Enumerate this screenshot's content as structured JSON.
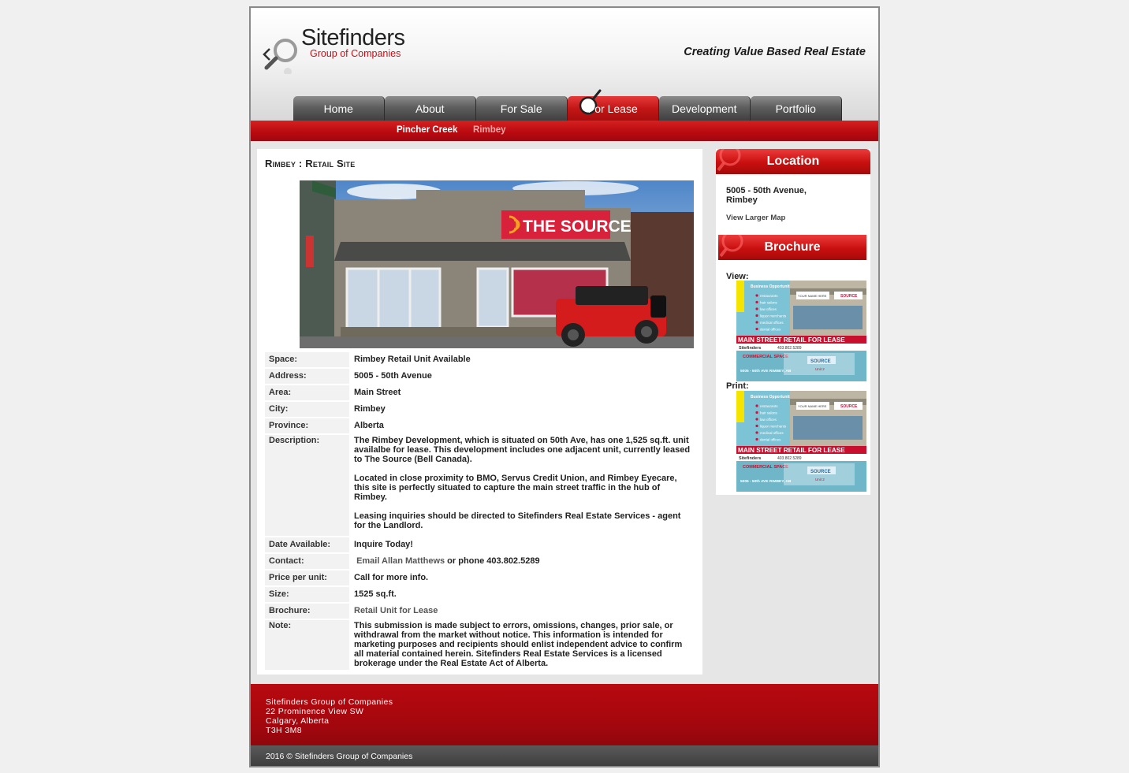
{
  "header": {
    "logo_name": "Sitefinders",
    "logo_sub": "Group of Companies",
    "tagline": "Creating Value Based Real Estate"
  },
  "nav": {
    "tabs": [
      {
        "label": "Home"
      },
      {
        "label": "About"
      },
      {
        "label": "For Sale"
      },
      {
        "label": "For Lease",
        "active": true
      },
      {
        "label": "Development"
      },
      {
        "label": "Portfolio"
      }
    ]
  },
  "subnav": {
    "items": [
      {
        "label": "Pincher Creek"
      },
      {
        "label": "Rimbey"
      }
    ]
  },
  "main": {
    "title": "Rimbey : Retail Site",
    "photo_sign": "THE SOURCE",
    "details": {
      "space_label": "Space:",
      "space": "Rimbey Retail Unit Available",
      "address_label": "Address:",
      "address": "5005 - 50th Avenue",
      "area_label": "Area:",
      "area": "Main Street",
      "city_label": "City:",
      "city": "Rimbey",
      "province_label": "Province:",
      "province": "Alberta",
      "description_label": "Description:",
      "description_p1": "The Rimbey Development, which is situated on 50th Ave, has one 1,525 sq.ft. unit availalbe for lease. This development includes one adjacent unit, currently leased to The Source (Bell Canada).",
      "description_p2": "Located in close proximity to BMO, Servus Credit Union, and Rimbey Eyecare, this site is perfectly situated to capture the main street traffic in the hub of Rimbey.",
      "description_p3": "Leasing inquiries should be directed to Sitefinders Real Estate Services - agent for the Landlord.",
      "date_label": "Date Available:",
      "date": "Inquire Today!",
      "contact_label": "Contact:",
      "contact_link": "Email Allan Matthews",
      "contact_rest": " or phone 403.802.5289",
      "price_label": "Price per unit:",
      "price": "Call for more info.",
      "size_label": "Size:",
      "size": "1525 sq.ft.",
      "brochure_label": "Brochure:",
      "brochure_link": "Retail Unit for Lease",
      "note_label": "Note:",
      "note": "This submission is made subject to errors, omissions, changes, prior sale, or withdrawal from the market without notice. This information is intended for marketing purposes and recipients should enlist independent advice to confirm all material contained herein. Sitefinders Real Estate Services is a licensed brokerage under the Real Estate Act of Alberta."
    }
  },
  "sidebar": {
    "location_title": "Location",
    "location_line1": "5005 - 50th Avenue,",
    "location_line2": "Rimbey",
    "view_map": "View Larger Map",
    "brochure_title": "Brochure",
    "view_label": "View:",
    "print_label": "Print:",
    "brochure_thumb": {
      "box_title": "Business Opportunities",
      "list": [
        "restaurants",
        "hair salons",
        "law offices",
        "liquor merchants",
        "medical offices",
        "dental offices"
      ],
      "banner": "MAIN STREET RETAIL FOR LEASE",
      "phone": "403.802.5289",
      "logo": "Sitefinders",
      "space_label": "COMMERCIAL SPACE",
      "space_address": "5005 - 50th AVE RIMBEY, AB",
      "store": "SOURCE",
      "unit": "Unit 2",
      "sign_text": "YOUR NAME HERE"
    }
  },
  "footer": {
    "line1": "Sitefinders Group of Companies",
    "line2": "22 Prominence View SW",
    "line3": "Calgary, Alberta",
    "line4": "T3H 3M8",
    "copyright": "2016 © Sitefinders Group of Companies"
  },
  "colors": {
    "brand_red": "#b8090f",
    "nav_grey": "#5f5f5f",
    "footer_bar": "#3c3c3c"
  }
}
